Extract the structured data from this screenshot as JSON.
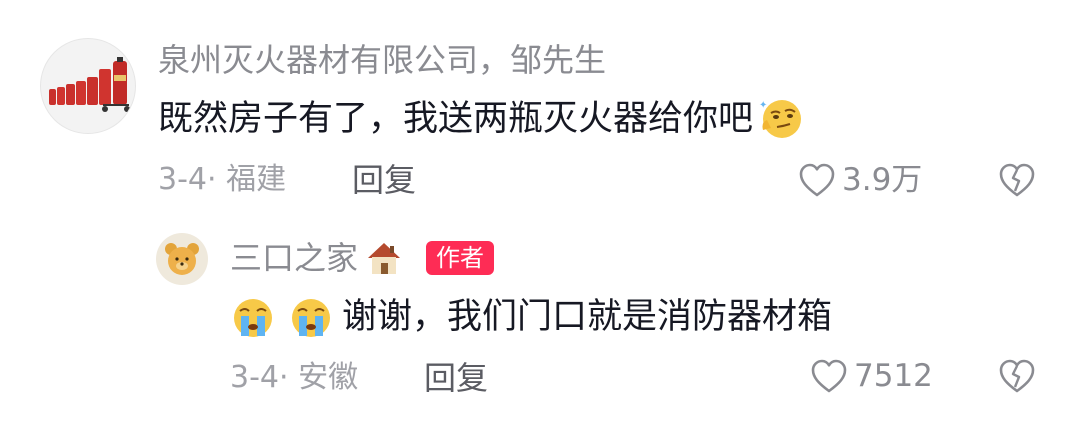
{
  "comments": [
    {
      "username": "泉州灭火器材有限公司，邹先生",
      "text": "既然房子有了，我送两瓶灭火器给你吧",
      "trailing_emoji": "smirk-face-emoji",
      "date_location": "3-4· 福建",
      "reply_label": "回复",
      "likes": "3.9万",
      "avatar_icon": "fire-extinguishers-avatar"
    },
    {
      "username": "三口之家",
      "name_emoji": "house-emoji",
      "badge": "作者",
      "leading_emojis": [
        "crying-face-emoji",
        "crying-face-emoji"
      ],
      "text": "谢谢，我们门口就是消防器材箱",
      "date_location": "3-4· 安徽",
      "reply_label": "回复",
      "likes": "7512",
      "avatar_icon": "bear-toy-avatar"
    }
  ],
  "colors": {
    "badge": "#fe2c55",
    "username": "#8a8b91",
    "meta": "#a0a1a7",
    "text": "#161823"
  }
}
